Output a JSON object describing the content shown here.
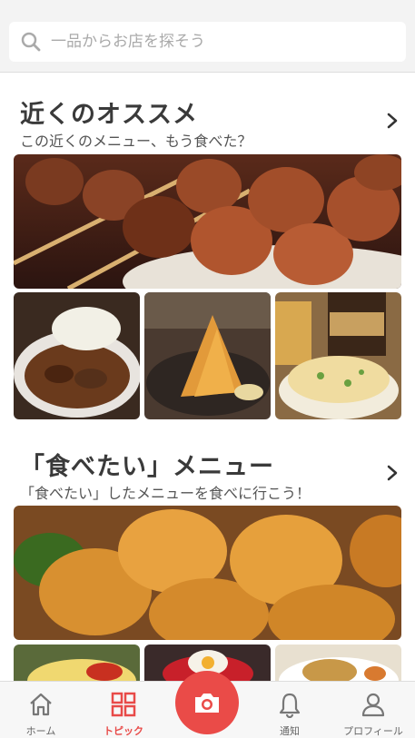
{
  "search": {
    "placeholder": "一品からお店を探そう"
  },
  "sections": [
    {
      "title": "近くのオススメ",
      "subtitle": "この近くのメニュー、もう食べた？"
    },
    {
      "title": "「食べたい」メニュー",
      "subtitle": "「食べたい」したメニューを食べに行こう！"
    }
  ],
  "photos": {
    "section1": [
      "yakitori-skewers",
      "beef-stew-with-cabbage",
      "fried-shrimp",
      "potato-salad-with-beer"
    ],
    "section2": [
      "karaage-fried-chicken",
      "omurice",
      "dish-with-egg",
      "dish-on-plate"
    ]
  },
  "tabbar": {
    "items": [
      {
        "label": "ホーム",
        "icon": "home-icon"
      },
      {
        "label": "トピック",
        "icon": "grid-icon",
        "active": true
      },
      {
        "label": "通知",
        "icon": "bell-icon"
      },
      {
        "label": "プロフィール",
        "icon": "person-icon"
      }
    ],
    "camera_icon": "camera-icon"
  },
  "colors": {
    "accent": "#e84a48",
    "background": "#f3f3f3"
  }
}
